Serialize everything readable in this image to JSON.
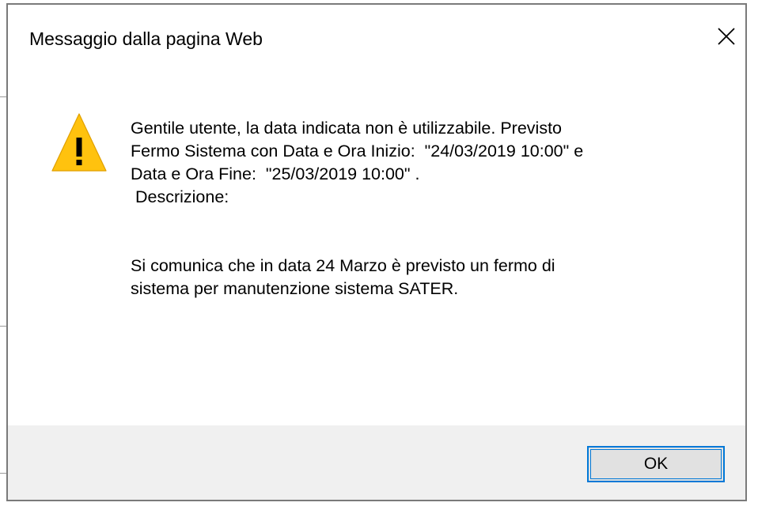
{
  "dialog": {
    "title": "Messaggio dalla pagina Web",
    "close_icon": "close-icon",
    "warning_icon": "warning-icon",
    "message_lines": [
      "Gentile utente, la data indicata non è utilizzabile. Previsto",
      "Fermo Sistema con Data e Ora Inizio:  \"24/03/2019 10:00\" e",
      "Data e Ora Fine:  \"25/03/2019 10:00\" .",
      " Descrizione:",
      "Si comunica che in data 24 Marzo è previsto un fermo di",
      "sistema per manutenzione sistema SATER."
    ],
    "ok_label": "OK"
  },
  "colors": {
    "accent": "#0078d7",
    "warning_fill": "#ffc20e",
    "footer_bg": "#f0f0f0"
  }
}
